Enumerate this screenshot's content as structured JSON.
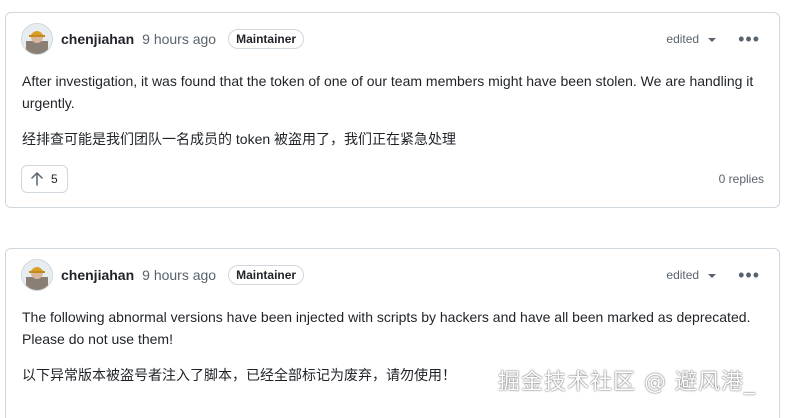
{
  "comments": [
    {
      "author": "chenjiahan",
      "time": "9 hours ago",
      "badge": "Maintainer",
      "edited_label": "edited",
      "body_en": "After investigation, it was found that the token of one of our team members might have been stolen. We are handling it urgently.",
      "body_zh": "经排查可能是我们团队一名成员的 token 被盗用了，我们正在紧急处理",
      "upvotes": "5",
      "replies": "0 replies"
    },
    {
      "author": "chenjiahan",
      "time": "9 hours ago",
      "badge": "Maintainer",
      "edited_label": "edited",
      "body_en": "The following abnormal versions have been injected with scripts by hackers and have all been marked as deprecated. Please do not use them!",
      "body_zh": "以下异常版本被盗号者注入了脚本，已经全部标记为废弃，请勿使用！"
    }
  ],
  "watermark": "掘金技术社区 @ 避风港_",
  "icons": {
    "upvote": "arrow-up-icon",
    "menu": "kebab-horizontal-icon",
    "dropdown": "triangle-down-icon"
  }
}
